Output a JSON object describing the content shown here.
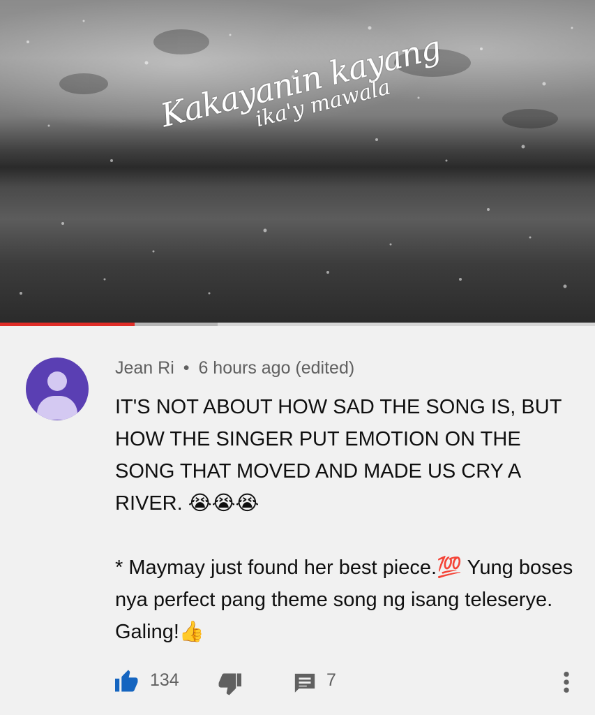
{
  "video": {
    "overlay_title_line1": "Kakayanin kayang",
    "overlay_title_line2": "ika'y mawala",
    "progress_played": 0.226,
    "progress_buffered": 0.366,
    "progress_color": "#e02d27"
  },
  "comment": {
    "author": "Jean Ri",
    "separator": "•",
    "time": "6 hours ago (edited)",
    "avatar_color": "#5a3fb3",
    "paragraph1": "IT'S NOT ABOUT HOW SAD THE SONG IS, BUT HOW THE SINGER PUT EMOTION ON THE SONG  THAT MOVED AND MADE US CRY A RIVER. 😭😭😭",
    "paragraph2": "* Maymay just found her best piece.💯 Yung boses nya perfect pang theme song ng isang teleserye. Galing!👍",
    "like_count": "134",
    "reply_count": "7"
  },
  "icons": [
    "like-icon",
    "dislike-icon",
    "reply-icon",
    "more-vert-icon"
  ],
  "colors": {
    "like_active": "#1565c0",
    "icon_gray": "#606060"
  }
}
